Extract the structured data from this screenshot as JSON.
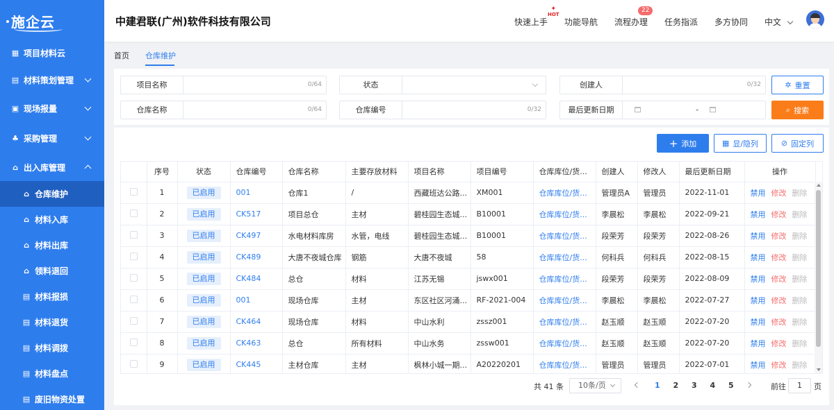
{
  "brand": {
    "logo": "施企云"
  },
  "sidebar": {
    "items": [
      {
        "label": "项目材料云",
        "icon": "grid-icon",
        "chevron": ""
      },
      {
        "label": "材料策划管理",
        "icon": "plan-icon",
        "chevron": "down"
      },
      {
        "label": "现场报量",
        "icon": "report-icon",
        "chevron": "down"
      },
      {
        "label": "采购管理",
        "icon": "purchase-icon",
        "chevron": "down"
      },
      {
        "label": "出入库管理",
        "icon": "warehouse-icon",
        "chevron": "up"
      }
    ],
    "subitems": [
      {
        "label": "仓库维护",
        "active": true
      },
      {
        "label": "材料入库",
        "active": false
      },
      {
        "label": "材料出库",
        "active": false
      },
      {
        "label": "领料退回",
        "active": false
      },
      {
        "label": "材料报损",
        "active": false
      },
      {
        "label": "材料退货",
        "active": false
      },
      {
        "label": "材料调拨",
        "active": false
      },
      {
        "label": "材料盘点",
        "active": false
      },
      {
        "label": "废旧物资处置",
        "active": false
      }
    ]
  },
  "header": {
    "company": "中建君联(广州)软件科技有限公司",
    "nav": {
      "quick_start": "快速上手",
      "hot": "HOT",
      "func_nav": "功能导航",
      "process": "流程办理",
      "process_badge": "22",
      "task": "任务指派",
      "collab": "多方协同",
      "lang": "中文"
    }
  },
  "tabs": {
    "home": "首页",
    "current": "仓库维护"
  },
  "filter": {
    "project_name": {
      "label": "项目名称",
      "count": "0/64"
    },
    "status": {
      "label": "状态"
    },
    "creator": {
      "label": "创建人",
      "count": "0/32"
    },
    "warehouse_name": {
      "label": "仓库名称",
      "count": "0/64"
    },
    "warehouse_code": {
      "label": "仓库编号",
      "count": "0/32"
    },
    "last_update": {
      "label": "最后更新日期",
      "separator": "-"
    },
    "reset": "重置",
    "search": "搜索"
  },
  "toolbar": {
    "add": "添加",
    "show_hide": "显/隐列",
    "fix": "固定列"
  },
  "table": {
    "headers": [
      "序号",
      "状态",
      "仓库编号",
      "仓库名称",
      "主要存放材料",
      "项目名称",
      "项目编号",
      "仓库库位/货...",
      "创建人",
      "修改人",
      "最后更新日期",
      "操作"
    ],
    "rows": [
      [
        "1",
        "已启用",
        "001",
        "仓库1",
        "/",
        "西藏班达公路...",
        "XM001",
        "仓库库位/货...",
        "管理员A",
        "管理员",
        "2022-11-01"
      ],
      [
        "2",
        "已启用",
        "CK517",
        "项目总仓",
        "主材",
        "碧桂园生态城...",
        "B10001",
        "仓库库位/货...",
        "李晨松",
        "李晨松",
        "2022-09-21"
      ],
      [
        "3",
        "已启用",
        "CK497",
        "水电材料库房",
        "水管，电线",
        "碧桂园生态城...",
        "B10001",
        "仓库库位/货...",
        "段荣芳",
        "段荣芳",
        "2022-08-26"
      ],
      [
        "4",
        "已启用",
        "CK489",
        "大唐不夜城仓库",
        "钢筋",
        "大唐不夜城",
        "58",
        "仓库库位/货...",
        "何科兵",
        "何科兵",
        "2022-08-15"
      ],
      [
        "5",
        "已启用",
        "CK484",
        "总仓",
        "材料",
        "江苏无锡",
        "jswx001",
        "仓库库位/货...",
        "段荣芳",
        "段荣芳",
        "2022-08-09"
      ],
      [
        "6",
        "已启用",
        "001",
        "现场仓库",
        "主材",
        "东区社区河涌...",
        "RF-2021-004",
        "仓库库位/货...",
        "李晨松",
        "李晨松",
        "2022-07-27"
      ],
      [
        "7",
        "已启用",
        "CK464",
        "现场仓库",
        "材料",
        "中山水利",
        "zssz001",
        "仓库库位/货...",
        "赵玉顺",
        "赵玉顺",
        "2022-07-20"
      ],
      [
        "8",
        "已启用",
        "CK463",
        "总仓",
        "所有材料",
        "中山水务",
        "zssw001",
        "仓库库位/货...",
        "赵玉顺",
        "赵玉顺",
        "2022-07-20"
      ],
      [
        "9",
        "已启用",
        "CK445",
        "主材仓库",
        "主材",
        "枫林小城一期...",
        "A20220201",
        "仓库库位/货...",
        "管理员",
        "管理员",
        "2022-07-01"
      ]
    ],
    "ops": {
      "disable": "禁用",
      "edit": "修改",
      "delete": "删除"
    }
  },
  "pagination": {
    "total": "共 41 条",
    "page_size": "10条/页",
    "pages": [
      "1",
      "2",
      "3",
      "4",
      "5"
    ],
    "current": "1",
    "goto_label": "前往",
    "goto_value": "1",
    "goto_suffix": "页"
  },
  "colors": {
    "primary": "#2e7ded",
    "orange": "#fa7d1a",
    "danger": "#f56c6c",
    "sidebar": "#2e7ded"
  }
}
